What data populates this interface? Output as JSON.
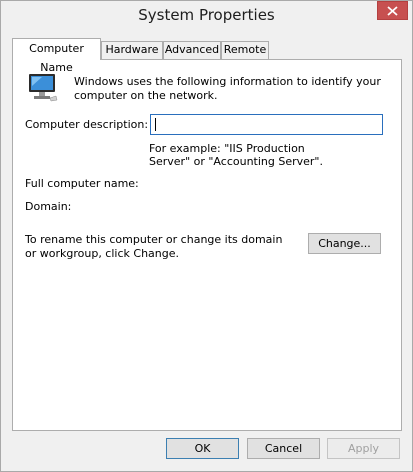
{
  "window": {
    "title": "System Properties",
    "close_label": "✕"
  },
  "tabs": [
    {
      "label": "Computer Name",
      "active": true
    },
    {
      "label": "Hardware"
    },
    {
      "label": "Advanced"
    },
    {
      "label": "Remote"
    }
  ],
  "panel": {
    "intro": "Windows uses the following information to identify your computer on the network.",
    "description_label": "Computer description:",
    "description_value": "",
    "example_hint": "For example: \"IIS Production Server\" or \"Accounting Server\".",
    "full_name_label": "Full computer name:",
    "domain_label": "Domain:",
    "rename_text": "To rename this computer or change its domain or workgroup, click Change.",
    "change_button": "Change..."
  },
  "footer": {
    "ok": "OK",
    "cancel": "Cancel",
    "apply": "Apply"
  }
}
